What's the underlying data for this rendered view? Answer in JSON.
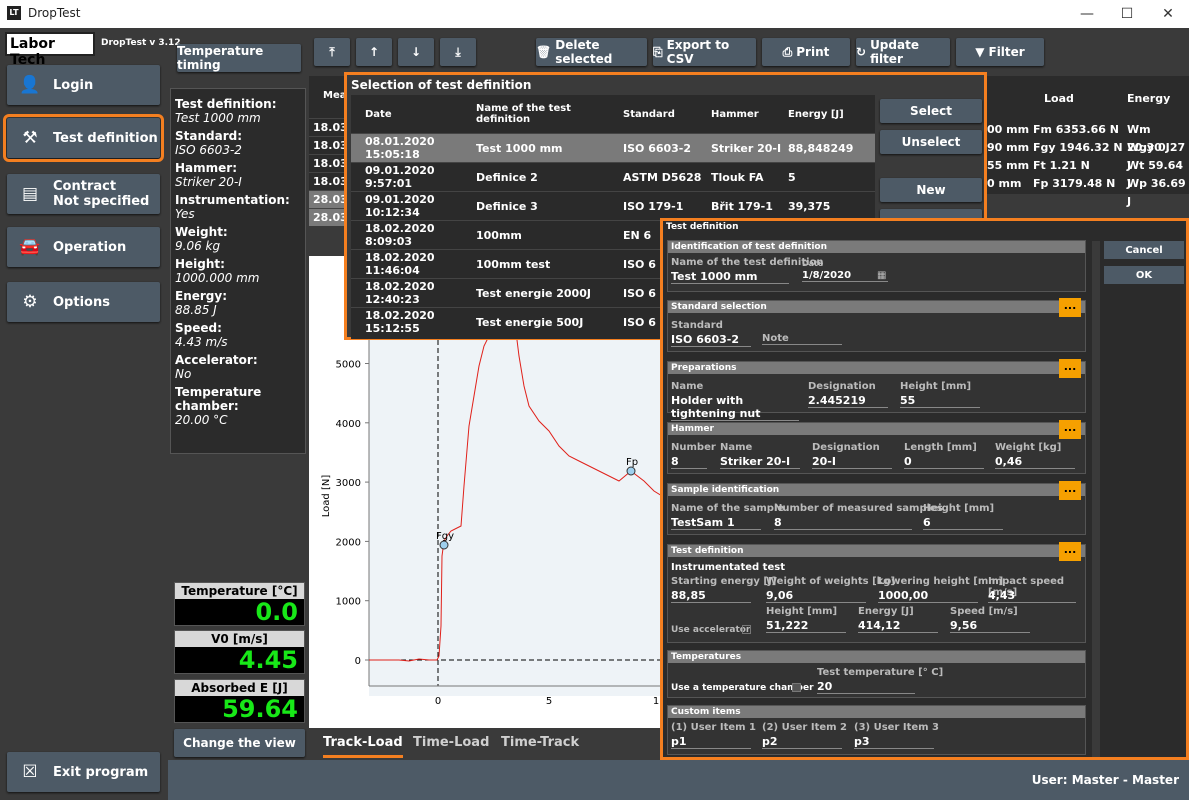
{
  "window": {
    "title": "DropTest",
    "logo": "Labor Tech",
    "version": "DropTest v 3.12"
  },
  "nav": {
    "login": "Login",
    "test_definition": "Test definition",
    "contract": "Contract",
    "contract_status": "Not specified",
    "operation": "Operation",
    "options": "Options",
    "exit": "Exit program"
  },
  "toolbar": {
    "temperature_timing": "Temperature timing",
    "delete": "Delete selected",
    "export": "Export to CSV",
    "print": "Print",
    "update_filter": "Update filter",
    "filter": "Filter"
  },
  "info": [
    {
      "label": "Test definition:",
      "value": "Test 1000 mm"
    },
    {
      "label": "Standard:",
      "value": "ISO 6603-2"
    },
    {
      "label": "Hammer:",
      "value": "Striker 20-I"
    },
    {
      "label": "Instrumentation:",
      "value": "Yes"
    },
    {
      "label": "Weight:",
      "value": "9.06   kg"
    },
    {
      "label": "Height:",
      "value": "1000.000   mm"
    },
    {
      "label": "Energy:",
      "value": "88.85   J"
    },
    {
      "label": "Speed:",
      "value": "4.43   m/s"
    },
    {
      "label": "Accelerator:",
      "value": "No"
    },
    {
      "label": "Temperature chamber:",
      "value": "20.00 °C"
    }
  ],
  "gauges": [
    {
      "label": "Temperature [°C]",
      "value": "0.0"
    },
    {
      "label": "V0 [m/s]",
      "value": "4.45"
    },
    {
      "label": "Absorbed E [J]",
      "value": "59.64"
    }
  ],
  "change_view": "Change the view",
  "left_table": {
    "header": "Mea",
    "rows": [
      "18.03",
      "18.03",
      "18.03",
      "18.03",
      "28.03",
      "28.03"
    ]
  },
  "right_table": {
    "headers": [
      "Load",
      "Energy"
    ],
    "rows": [
      [
        "00 mm",
        "Fm 6353.66 N",
        "Wm 20.30 J"
      ],
      [
        "90 mm",
        "Fgy 1946.32 N",
        "Wgy 0.27 J"
      ],
      [
        "55 mm",
        "Ft 1.21 N",
        "Wt 59.64 J"
      ],
      [
        "0 mm",
        "Fp 3179.48 N",
        "Wp 36.69 J"
      ]
    ]
  },
  "chart_data": {
    "type": "line",
    "ylabel": "Load [N]",
    "yticks": [
      "0",
      "1000",
      "2000",
      "3000",
      "4000",
      "5000",
      "60"
    ],
    "xticks": [
      "0",
      "5",
      "1"
    ],
    "markers": [
      "Fgy",
      "Fp"
    ]
  },
  "tabs": [
    "Track-Load",
    "Time-Load",
    "Time-Track"
  ],
  "selection": {
    "title": "Selection of test definition",
    "headers": [
      "Date",
      "Name of the test definition",
      "Standard",
      "Hammer",
      "Energy [J]"
    ],
    "rows": [
      [
        "08.01.2020 15:05:18",
        "Test 1000 mm",
        "ISO 6603-2",
        "Striker 20-I",
        "88,848249"
      ],
      [
        "09.01.2020 9:57:01",
        "Definice 2",
        "ASTM D5628",
        "Tlouk FA",
        "5"
      ],
      [
        "09.01.2020 10:12:34",
        "Definice 3",
        "ISO 179-1",
        "Břit 179-1",
        "39,375"
      ],
      [
        "18.02.2020 8:09:03",
        "100mm",
        "EN 6",
        "",
        ""
      ],
      [
        "18.02.2020 11:46:04",
        "100mm test",
        "ISO 6",
        "",
        ""
      ],
      [
        "18.02.2020 12:40:23",
        "Test energie 2000J",
        "ISO 6",
        "",
        ""
      ],
      [
        "18.02.2020 15:12:55",
        "Test energie 500J",
        "ISO 6",
        "",
        ""
      ]
    ],
    "buttons": {
      "select": "Select",
      "unselect": "Unselect",
      "new": "New"
    }
  },
  "def": {
    "title": "Test definition",
    "cancel": "Cancel",
    "ok": "OK",
    "more": "...",
    "ident": {
      "h": "Identification of test definition",
      "name_l": "Name of the test definition",
      "name_v": "Test 1000 mm",
      "date_l": "Date",
      "date_v": "1/8/2020"
    },
    "std": {
      "h": "Standard selection",
      "std_l": "Standard",
      "std_v": "ISO 6603-2",
      "note_l": "Note"
    },
    "prep": {
      "h": "Preparations",
      "name_l": "Name",
      "name_v": "Holder with tightening nut",
      "des_l": "Designation",
      "des_v": "2.445219",
      "ht_l": "Height [mm]",
      "ht_v": "55"
    },
    "ham": {
      "h": "Hammer",
      "num_l": "Number",
      "num_v": "8",
      "name_l": "Name",
      "name_v": "Striker 20-I",
      "des_l": "Designation",
      "des_v": "20-I",
      "len_l": "Length [mm]",
      "len_v": "0",
      "w_l": "Weight [kg]",
      "w_v": "0,46"
    },
    "sample": {
      "h": "Sample identification",
      "name_l": "Name of the sample",
      "name_v": "TestSam 1",
      "num_l": "Number of measured samples",
      "num_v": "8",
      "ht_l": "Height [mm]",
      "ht_v": "6"
    },
    "tdef": {
      "h": "Test definition",
      "sub": "Instrumentated test",
      "se_l": "Starting energy [J]",
      "se_v": "88,85",
      "ww_l": "Weight of weights [kg]",
      "ww_v": "9,06",
      "lh_l": "Lowering height [mm]",
      "lh_v": "1000,00",
      "is_l": "Impact speed [m/s]",
      "is_v": "4,43",
      "acc_l": "Use accelerator",
      "h_l": "Height [mm]",
      "h_v": "51,222",
      "e_l": "Energy [J]",
      "e_v": "414,12",
      "s_l": "Speed [m/s]",
      "s_v": "9,56"
    },
    "temp": {
      "h": "Temperatures",
      "use_l": "Use a temperature chamber",
      "tt_l": "Test temperature [° C]",
      "tt_v": "20"
    },
    "custom": {
      "h": "Custom items",
      "u1_l": "(1) User Item 1",
      "u1_v": "p1",
      "u2_l": "(2) User Item 2",
      "u2_v": "p2",
      "u3_l": "(3) User Item 3",
      "u3_v": "p3"
    }
  },
  "status": {
    "user": "User:  Master  -  Master"
  }
}
